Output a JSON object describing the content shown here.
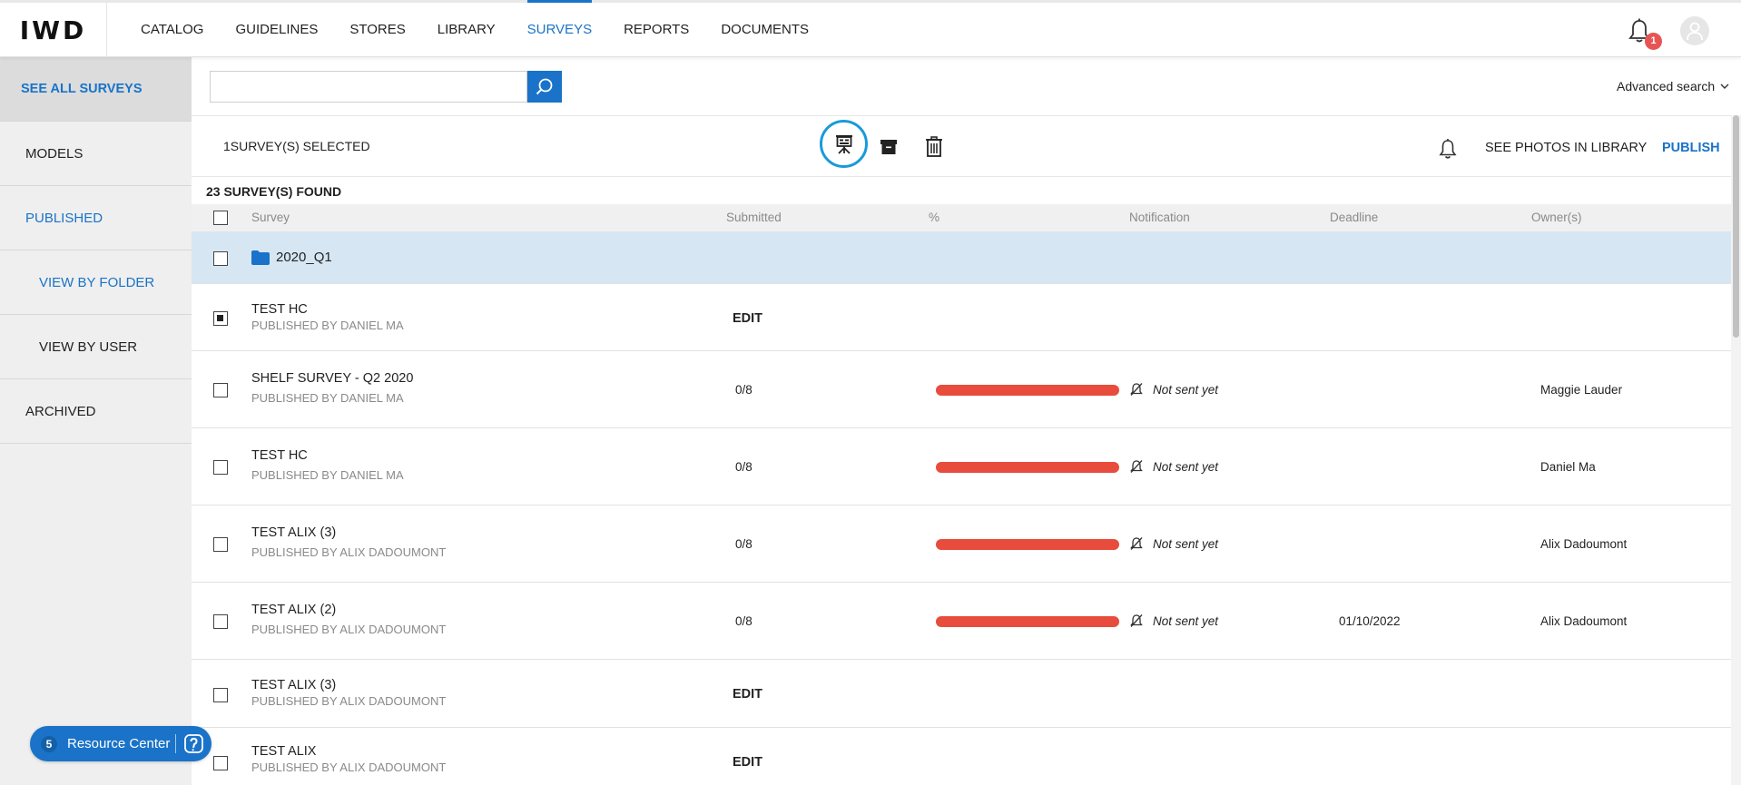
{
  "app": {
    "logo": "IWD"
  },
  "nav": {
    "items": [
      {
        "label": "CATALOG",
        "active": false
      },
      {
        "label": "GUIDELINES",
        "active": false
      },
      {
        "label": "STORES",
        "active": false
      },
      {
        "label": "LIBRARY",
        "active": false
      },
      {
        "label": "SURVEYS",
        "active": true
      },
      {
        "label": "REPORTS",
        "active": false
      },
      {
        "label": "DOCUMENTS",
        "active": false
      }
    ],
    "notification_count": "1"
  },
  "sidebar": {
    "items": [
      {
        "label": "SEE ALL SURVEYS"
      },
      {
        "label": "MODELS"
      },
      {
        "label": "PUBLISHED"
      },
      {
        "label": "VIEW BY FOLDER"
      },
      {
        "label": "VIEW BY USER"
      },
      {
        "label": "ARCHIVED"
      }
    ]
  },
  "search": {
    "value": "",
    "placeholder": "",
    "advanced_label": "Advanced search"
  },
  "action_bar": {
    "selected_text": "1SURVEY(S) SELECTED",
    "see_photos_label": "SEE PHOTOS IN LIBRARY",
    "publish_label": "PUBLISH"
  },
  "results": {
    "found_text": "23 SURVEY(S) FOUND"
  },
  "table": {
    "columns": [
      "Survey",
      "Submitted",
      "%",
      "Notification",
      "Deadline",
      "Owner(s)"
    ],
    "folder": {
      "name": "2020_Q1"
    },
    "rows": [
      {
        "title": "TEST HC",
        "subtitle": "PUBLISHED BY DANIEL MA",
        "edit": "EDIT",
        "checked": true
      },
      {
        "title": "SHELF SURVEY - Q2 2020",
        "subtitle": "PUBLISHED BY DANIEL MA",
        "submitted": "0/8",
        "progress": 0.0,
        "notification": "Not sent yet",
        "deadline": "",
        "owner": "Maggie Lauder"
      },
      {
        "title": "TEST HC",
        "subtitle": "PUBLISHED BY DANIEL MA",
        "submitted": "0/8",
        "progress": 0.0,
        "notification": "Not sent yet",
        "deadline": "",
        "owner": "Daniel Ma"
      },
      {
        "title": "TEST ALIX (3)",
        "subtitle": "PUBLISHED BY ALIX DADOUMONT",
        "submitted": "0/8",
        "progress": 0.0,
        "notification": "Not sent yet",
        "deadline": "",
        "owner": "Alix Dadoumont"
      },
      {
        "title": "TEST ALIX (2)",
        "subtitle": "PUBLISHED BY ALIX DADOUMONT",
        "submitted": "0/8",
        "progress": 0.0,
        "notification": "Not sent yet",
        "deadline": "01/10/2022",
        "owner": "Alix Dadoumont"
      },
      {
        "title": "TEST ALIX (3)",
        "subtitle": "PUBLISHED BY ALIX DADOUMONT",
        "edit": "EDIT"
      },
      {
        "title": "TEST ALIX",
        "subtitle": "PUBLISHED BY ALIX DADOUMONT",
        "edit": "EDIT"
      }
    ]
  },
  "resource_center": {
    "count": "5",
    "label": "Resource Center"
  },
  "colors": {
    "accent": "#1a73c8",
    "progress_bar": "#e74c3c",
    "folder_row": "#d6e7f3",
    "badge": "#e75454"
  }
}
